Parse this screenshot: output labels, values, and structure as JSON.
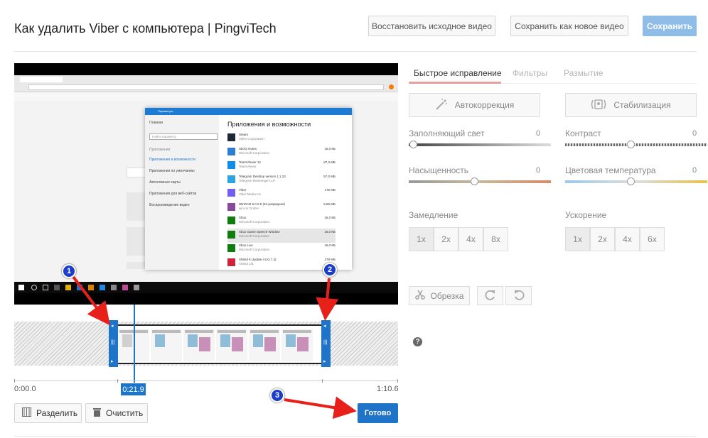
{
  "header": {
    "title": "Как удалить Viber с компьютера | PingviTech",
    "restore_label": "Восстановить исходное видео",
    "save_new_label": "Сохранить как новое видео",
    "save_label": "Сохранить"
  },
  "video_frame": {
    "settings_heading": "Приложения и возможности",
    "settings_window_title": "Параметры",
    "search_placeholder": "Найти параметр",
    "sidebar_items": [
      "Главная",
      "Приложения",
      "Приложения и возможности",
      "Приложения по умолчанию",
      "Автономные карты",
      "Приложения для веб-сайтов",
      "Воспроизведение видео"
    ],
    "apps": [
      {
        "name": "Steam",
        "publisher": "Valve Corporation",
        "size": "",
        "color": "#1b2838"
      },
      {
        "name": "Sticky Notes",
        "publisher": "Microsoft Corporation",
        "size": "16,0 КБ",
        "color": "#2d7dd2"
      },
      {
        "name": "TeamViewer 12",
        "publisher": "TeamViewer",
        "size": "87,3 МБ",
        "color": "#0e8ee9"
      },
      {
        "name": "Telegram Desktop version 1.1.23",
        "publisher": "Telegram Messenger LLP",
        "size": "57,0 МБ",
        "color": "#2ca5e0"
      },
      {
        "name": "Viber",
        "publisher": "Viber Media Inc.",
        "size": "175 МБ",
        "color": "#7360f2"
      },
      {
        "name": "WinRAR 5.0.0.0 (64-разрядная)",
        "publisher": "win.rar GmbH",
        "size": "5,86 МБ",
        "color": "#8a4a9c"
      },
      {
        "name": "Xbox",
        "publisher": "Microsoft Corporation",
        "size": "16,0 КБ",
        "color": "#107c10"
      },
      {
        "name": "Xbox Game Speech Window",
        "publisher": "Microsoft Corporation",
        "size": "16,0 КБ",
        "color": "#107c10"
      },
      {
        "name": "Xbox Live",
        "publisher": "Microsoft Corporation",
        "size": "16,0 КБ",
        "color": "#107c10"
      },
      {
        "name": "XMind 8 Update 4 (v3.7.4)",
        "publisher": "XMind Ltd.",
        "size": "279 МБ",
        "color": "#d1223b"
      }
    ]
  },
  "timeline": {
    "start_time": "0:00.0",
    "current_time": "0:21.9",
    "end_time": "1:10.6",
    "split_label": "Разделить",
    "clear_label": "Очистить",
    "done_label": "Готово"
  },
  "annotations": {
    "badge_1": "1",
    "badge_2": "2",
    "badge_3": "3",
    "arrow_color": "#e8201a",
    "badge_color": "#1a3ec9"
  },
  "panel": {
    "tabs": {
      "quick_fix": "Быстрое исправление",
      "filters": "Фильтры",
      "blur": "Размытие"
    },
    "autofix_label": "Автокоррекция",
    "stabilize_label": "Стабилизация",
    "fill_light": {
      "label": "Заполняющий свет",
      "value": "0"
    },
    "contrast": {
      "label": "Контраст",
      "value": "0"
    },
    "saturation": {
      "label": "Насыщенность",
      "value": "0"
    },
    "color_temp": {
      "label": "Цветовая температура",
      "value": "0"
    },
    "slowmo": {
      "label": "Замедление",
      "options": [
        "1x",
        "2x",
        "4x",
        "8x"
      ],
      "selected": "1x"
    },
    "timelapse": {
      "label": "Ускорение",
      "options": [
        "1x",
        "2x",
        "4x",
        "6x"
      ],
      "selected": "1x"
    },
    "trim_label": "Обрезка",
    "help_label": "?"
  }
}
